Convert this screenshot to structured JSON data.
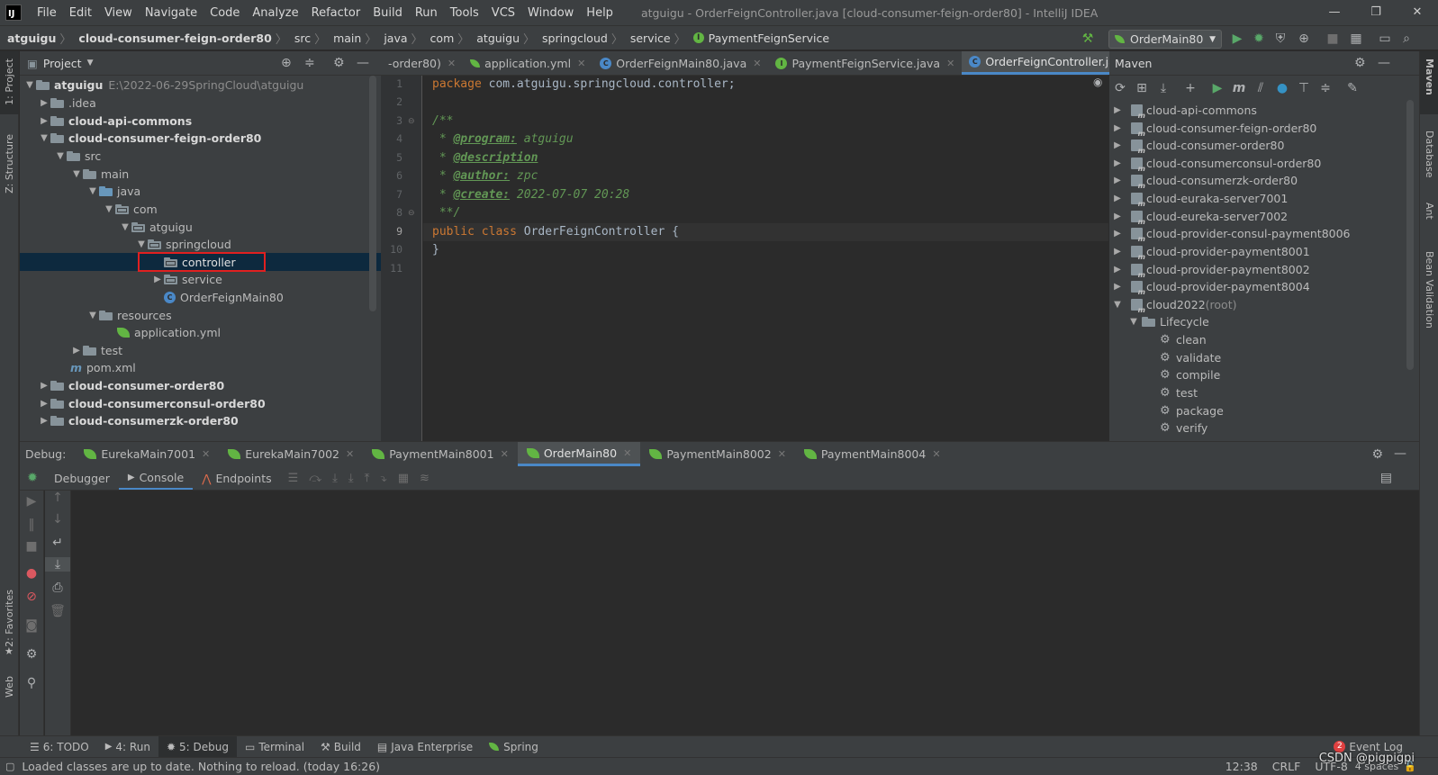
{
  "menubar": {
    "logo": "IJ",
    "items": [
      "File",
      "Edit",
      "View",
      "Navigate",
      "Code",
      "Analyze",
      "Refactor",
      "Build",
      "Run",
      "Tools",
      "VCS",
      "Window",
      "Help"
    ],
    "title": "atguigu - OrderFeignController.java [cloud-consumer-feign-order80] - IntelliJ IDEA",
    "window_controls": [
      "—",
      "❐",
      "✕"
    ]
  },
  "navbar": {
    "breadcrumbs": [
      "atguigu",
      "cloud-consumer-feign-order80",
      "src",
      "main",
      "java",
      "com",
      "atguigu",
      "springcloud",
      "service",
      "PaymentFeignService"
    ],
    "run_config": "OrderMain80"
  },
  "left_stripe": {
    "project": "1: Project",
    "structure": "Z: Structure",
    "favorites": "2: Favorites",
    "web": "Web"
  },
  "right_stripe": {
    "maven": "Maven",
    "database": "Database",
    "ant": "Ant",
    "bean_validation": "Bean Validation"
  },
  "project": {
    "title": "Project",
    "tree": [
      {
        "label": "atguigu",
        "extra": "E:\\2022-06-29SpringCloud\\atguigu"
      },
      {
        "label": ".idea"
      },
      {
        "label": "cloud-api-commons"
      },
      {
        "label": "cloud-consumer-feign-order80"
      },
      {
        "label": "src"
      },
      {
        "label": "main"
      },
      {
        "label": "java"
      },
      {
        "label": "com"
      },
      {
        "label": "atguigu"
      },
      {
        "label": "springcloud"
      },
      {
        "label": "controller"
      },
      {
        "label": "service"
      },
      {
        "label": "OrderFeignMain80"
      },
      {
        "label": "resources"
      },
      {
        "label": "application.yml"
      },
      {
        "label": "test"
      },
      {
        "label": "pom.xml"
      },
      {
        "label": "cloud-consumer-order80"
      },
      {
        "label": "cloud-consumerconsul-order80"
      },
      {
        "label": "cloud-consumerzk-order80"
      }
    ]
  },
  "editor": {
    "tabs": [
      "-order80)",
      "application.yml",
      "OrderFeignMain80.java",
      "PaymentFeignService.java",
      "OrderFeignController.java"
    ],
    "line_numbers": [
      "1",
      "2",
      "3",
      "4",
      "5",
      "6",
      "7",
      "8",
      "9",
      "10",
      "11"
    ],
    "code": {
      "l1_kw": "package",
      "l1_rest": " com.atguigu.springcloud.controller;",
      "l3": "/**",
      "l4_star": " * ",
      "l4_tag": "@program:",
      "l4_val": " atguigu",
      "l5_star": " * ",
      "l5_tag": "@description",
      "l6_star": " * ",
      "l6_tag": "@author:",
      "l6_val": " zpc",
      "l7_star": " * ",
      "l7_tag": "@create:",
      "l7_val": " 2022-07-07 20:28",
      "l8": " **/",
      "l9_kw": "public class",
      "l9_rest": " OrderFeignController {",
      "l10": "}"
    }
  },
  "maven": {
    "title": "Maven",
    "projects": [
      "cloud-api-commons",
      "cloud-consumer-feign-order80",
      "cloud-consumer-order80",
      "cloud-consumerconsul-order80",
      "cloud-consumerzk-order80",
      "cloud-euraka-server7001",
      "cloud-eureka-server7002",
      "cloud-provider-consul-payment8006",
      "cloud-provider-payment8001",
      "cloud-provider-payment8002",
      "cloud-provider-payment8004"
    ],
    "root": "cloud2022",
    "root_suffix": " (root)",
    "lifecycle": "Lifecycle",
    "phases": [
      "clean",
      "validate",
      "compile",
      "test",
      "package",
      "verify"
    ]
  },
  "debug": {
    "label": "Debug:",
    "tabs": [
      "EurekaMain7001",
      "EurekaMain7002",
      "PaymentMain8001",
      "OrderMain80",
      "PaymentMain8002",
      "PaymentMain8004"
    ],
    "subtabs": [
      "Debugger",
      "Console",
      "Endpoints"
    ]
  },
  "tool_tabs": [
    "6: TODO",
    "4: Run",
    "5: Debug",
    "Terminal",
    "Build",
    "Java Enterprise",
    "Spring"
  ],
  "event_log": {
    "count": "2",
    "label": "Event Log"
  },
  "status": {
    "message": "Loaded classes are up to date. Nothing to reload. (today 16:26)",
    "position": "12:38",
    "line_sep": "CRLF",
    "encoding": "UTF-8",
    "indent": "4 spaces",
    "watermark": "CSDN @pigpigpi"
  },
  "colors": {
    "keyword": "#cc7832",
    "comment": "#629755",
    "selection": "#0d293e",
    "highlight_box": "#e02020",
    "accent": "#4a88c7"
  }
}
